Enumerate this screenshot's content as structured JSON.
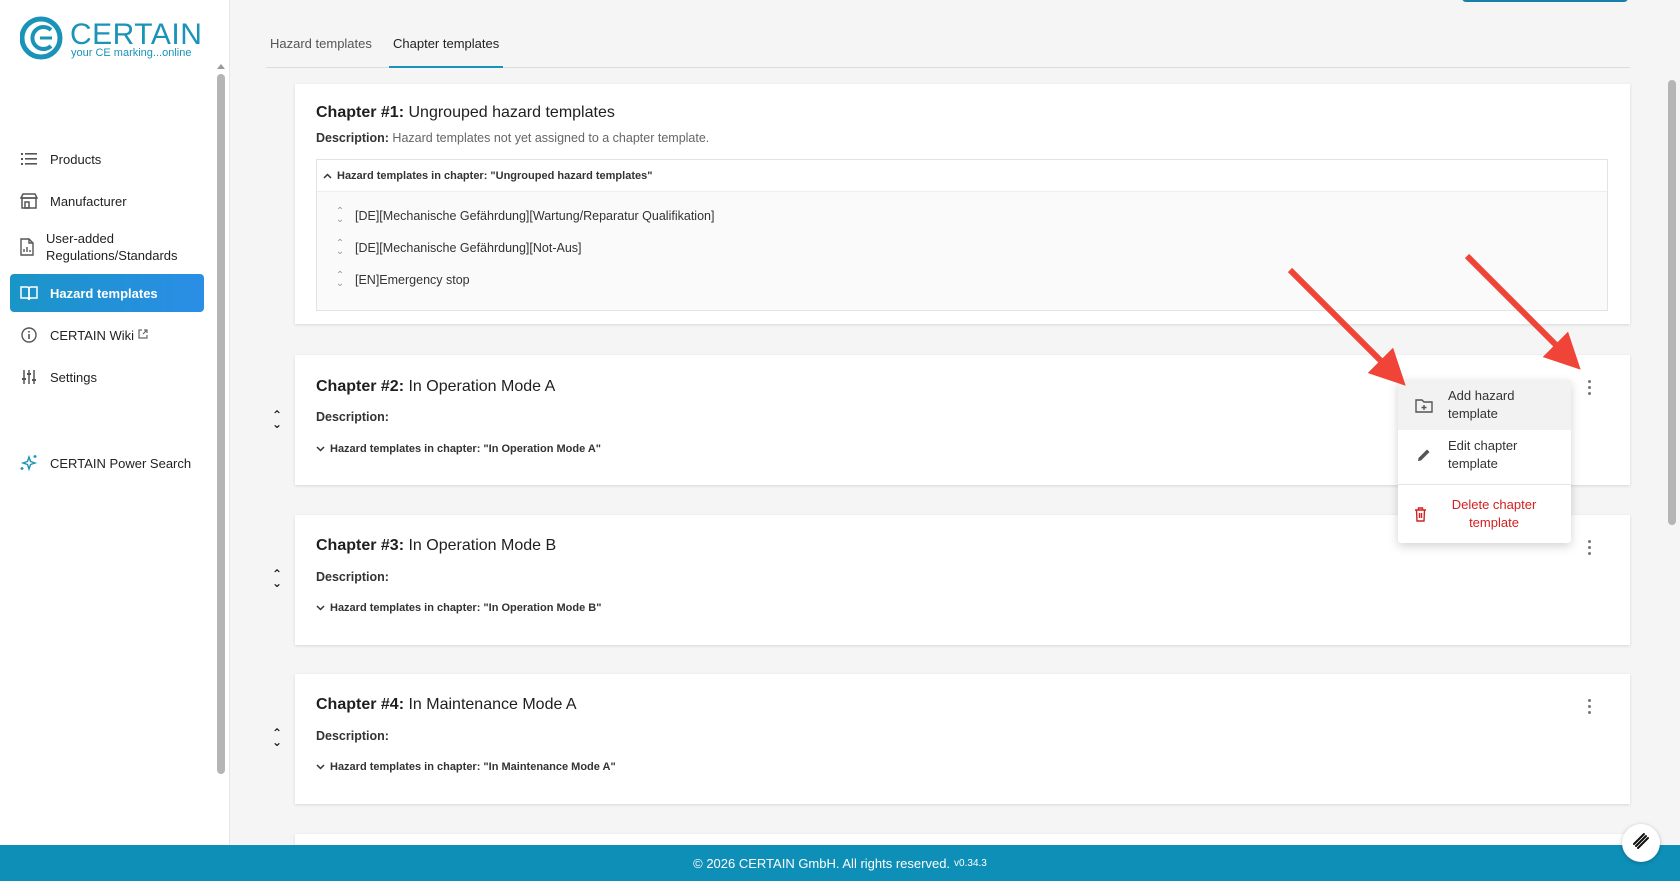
{
  "brand": {
    "name": "CERTAIN",
    "tagline": "your CE marking...online"
  },
  "sidebar": {
    "items": [
      {
        "label": "Products",
        "icon": "list-icon"
      },
      {
        "label": "Manufacturer",
        "icon": "store-icon"
      },
      {
        "label": "User-added Regulations/Standards",
        "icon": "document-icon"
      },
      {
        "label": "Hazard templates",
        "icon": "book-icon",
        "active": true
      },
      {
        "label": "CERTAIN Wiki",
        "icon": "info-icon"
      },
      {
        "label": "Settings",
        "icon": "sliders-icon"
      }
    ],
    "power_search": "CERTAIN Power Search"
  },
  "tabs": [
    {
      "label": "Hazard templates"
    },
    {
      "label": "Chapter templates",
      "active": true
    }
  ],
  "chapters": [
    {
      "number_label": "Chapter #1:",
      "title": "Ungrouped hazard templates",
      "desc_label": "Description:",
      "description": "Hazard templates not yet assigned to a chapter template.",
      "expander": "Hazard templates in chapter: \"Ungrouped hazard templates\"",
      "hazards": [
        "[DE][Mechanische Gefährdung][Wartung/Reparatur Qualifikation]",
        "[DE][Mechanische Gefährdung][Not-Aus]",
        "[EN]Emergency stop"
      ]
    },
    {
      "number_label": "Chapter #2:",
      "title": "In Operation Mode A",
      "desc_label": "Description:",
      "description": "",
      "expander": "Hazard templates in chapter: \"In Operation Mode A\""
    },
    {
      "number_label": "Chapter #3:",
      "title": "In Operation Mode B",
      "desc_label": "Description:",
      "description": "",
      "expander": "Hazard templates in chapter: \"In Operation Mode B\""
    },
    {
      "number_label": "Chapter #4:",
      "title": "In Maintenance Mode A",
      "desc_label": "Description:",
      "description": "",
      "expander": "Hazard templates in chapter: \"In Maintenance Mode A\""
    }
  ],
  "menu": {
    "add": "Add hazard template",
    "edit": "Edit chapter template",
    "delete": "Delete chapter template"
  },
  "footer": {
    "copyright": "© 2026 CERTAIN GmbH. All rights reserved.",
    "version": "v0.34.3"
  },
  "colors": {
    "accent": "#1a93b8",
    "footer": "#0e8fb8",
    "danger": "#d32020",
    "arrow": "#f04438"
  }
}
